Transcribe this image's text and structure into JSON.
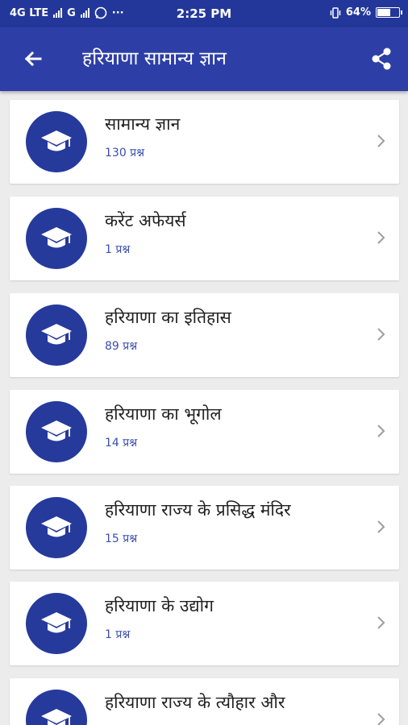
{
  "status_bar": {
    "network": "4G LTE",
    "network2": "G",
    "more": "···",
    "time": "2:25 PM",
    "battery": "64%",
    "battery_level": 0.64
  },
  "appbar": {
    "title": "हरियाणा सामान्य ज्ञान",
    "back_icon": "arrow-back-icon",
    "share_icon": "share-icon"
  },
  "items": [
    {
      "title": "सामान्य ज्ञान",
      "subtitle": "130 प्रश्न"
    },
    {
      "title": "करेंट अफेयर्स",
      "subtitle": "1 प्रश्न"
    },
    {
      "title": "हरियाणा का इतिहास",
      "subtitle": "89 प्रश्न"
    },
    {
      "title": "हरियाणा का भूगोल",
      "subtitle": "14 प्रश्न"
    },
    {
      "title": "हरियाणा राज्य के प्रसिद्ध मंदिर",
      "subtitle": "15 प्रश्न"
    },
    {
      "title": "हरियाणा के उद्योग",
      "subtitle": "1 प्रश्न"
    },
    {
      "title": "हरियाणा राज्य के त्यौहार और",
      "subtitle": ""
    }
  ],
  "colors": {
    "appbar": "#2d3fa6",
    "statusbar": "#23379a",
    "icon_circle": "#263a9c",
    "subtitle": "#3b4fae"
  }
}
